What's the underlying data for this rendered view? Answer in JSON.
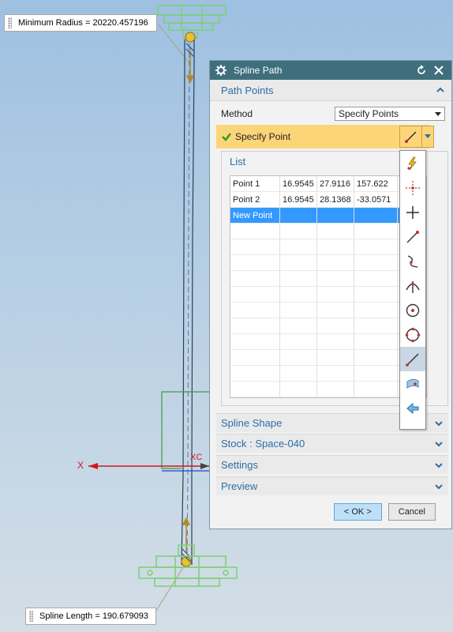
{
  "callouts": {
    "minimum_radius": "Minimum Radius = 20220.457196",
    "spline_length": "Spline Length = 190.679093"
  },
  "axis": {
    "x_label": "X",
    "xc_label": "XC"
  },
  "dialog": {
    "title": "Spline Path",
    "path_points": {
      "header": "Path Points",
      "method_label": "Method",
      "method_value": "Specify Points",
      "specify_point_label": "Specify Point",
      "list": {
        "header": "List",
        "rows": [
          [
            "Point 1",
            "16.9545",
            "27.9116",
            "157.622"
          ],
          [
            "Point 2",
            "16.9545",
            "28.1368",
            "-33.0571"
          ],
          [
            "New Point",
            "",
            "",
            ""
          ]
        ]
      }
    },
    "spline_shape": "Spline Shape",
    "stock": "Stock : Space-040",
    "settings": "Settings",
    "preview": "Preview",
    "ok": "< OK >",
    "cancel": "Cancel"
  },
  "colors": {
    "title_bar": "#3f6f7d",
    "section_text": "#2a6ea8",
    "highlight_row": "#fdd579",
    "selected_row": "#3399ff",
    "model_green": "#7ccf74",
    "axis_red": "#d01818"
  }
}
